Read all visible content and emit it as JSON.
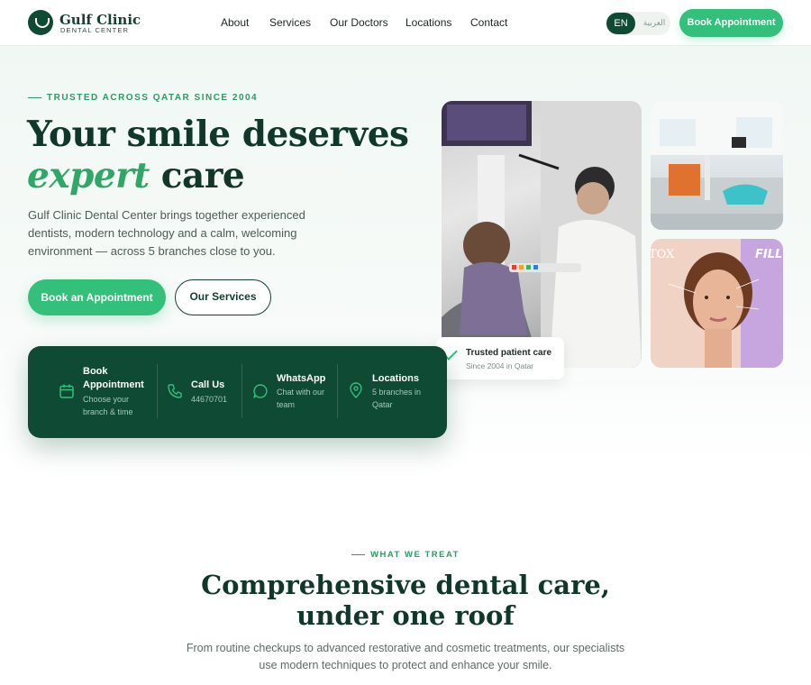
{
  "brand": {
    "name": "Gulf Clinic",
    "tagline": "DENTAL CENTER"
  },
  "nav": {
    "items": [
      "About",
      "Services",
      "Our Doctors",
      "Locations",
      "Contact"
    ]
  },
  "lang": {
    "en": "EN",
    "ar": "العربية"
  },
  "header": {
    "cta": "Book Appointment"
  },
  "hero": {
    "eyebrow": "TRUSTED ACROSS QATAR SINCE 2004",
    "title_line1": "Your smile deserves",
    "title_accent": "expert",
    "title_rest": " care",
    "description": "Gulf Clinic Dental Center brings together experienced dentists, modern technology and a calm, welcoming environment — across 5 branches close to you.",
    "primary_cta": "Book an Appointment",
    "secondary_cta": "Our Services"
  },
  "trust": {
    "title": "Trusted patient care",
    "subtitle": "Since 2004 in Qatar"
  },
  "photo_labels": {
    "tox": "TOX",
    "fill": "FILL"
  },
  "quick_actions": [
    {
      "title": "Book Appointment",
      "subtitle": "Choose your branch & time",
      "icon": "calendar-icon"
    },
    {
      "title": "Call Us",
      "subtitle": "44670701",
      "icon": "phone-icon"
    },
    {
      "title": "WhatsApp",
      "subtitle": "Chat with our team",
      "icon": "chat-icon"
    },
    {
      "title": "Locations",
      "subtitle": "5 branches in Qatar",
      "icon": "map-pin-icon"
    }
  ],
  "treat": {
    "eyebrow": "WHAT WE TREAT",
    "title_line1": "Comprehensive dental care,",
    "title_line2": "under one roof",
    "description": "From routine checkups to advanced restorative and cosmetic treatments, our specialists use modern techniques to protect and enhance your smile."
  },
  "colors": {
    "primary": "#0f4a35",
    "accent": "#32c07a",
    "heading": "#10382a"
  }
}
